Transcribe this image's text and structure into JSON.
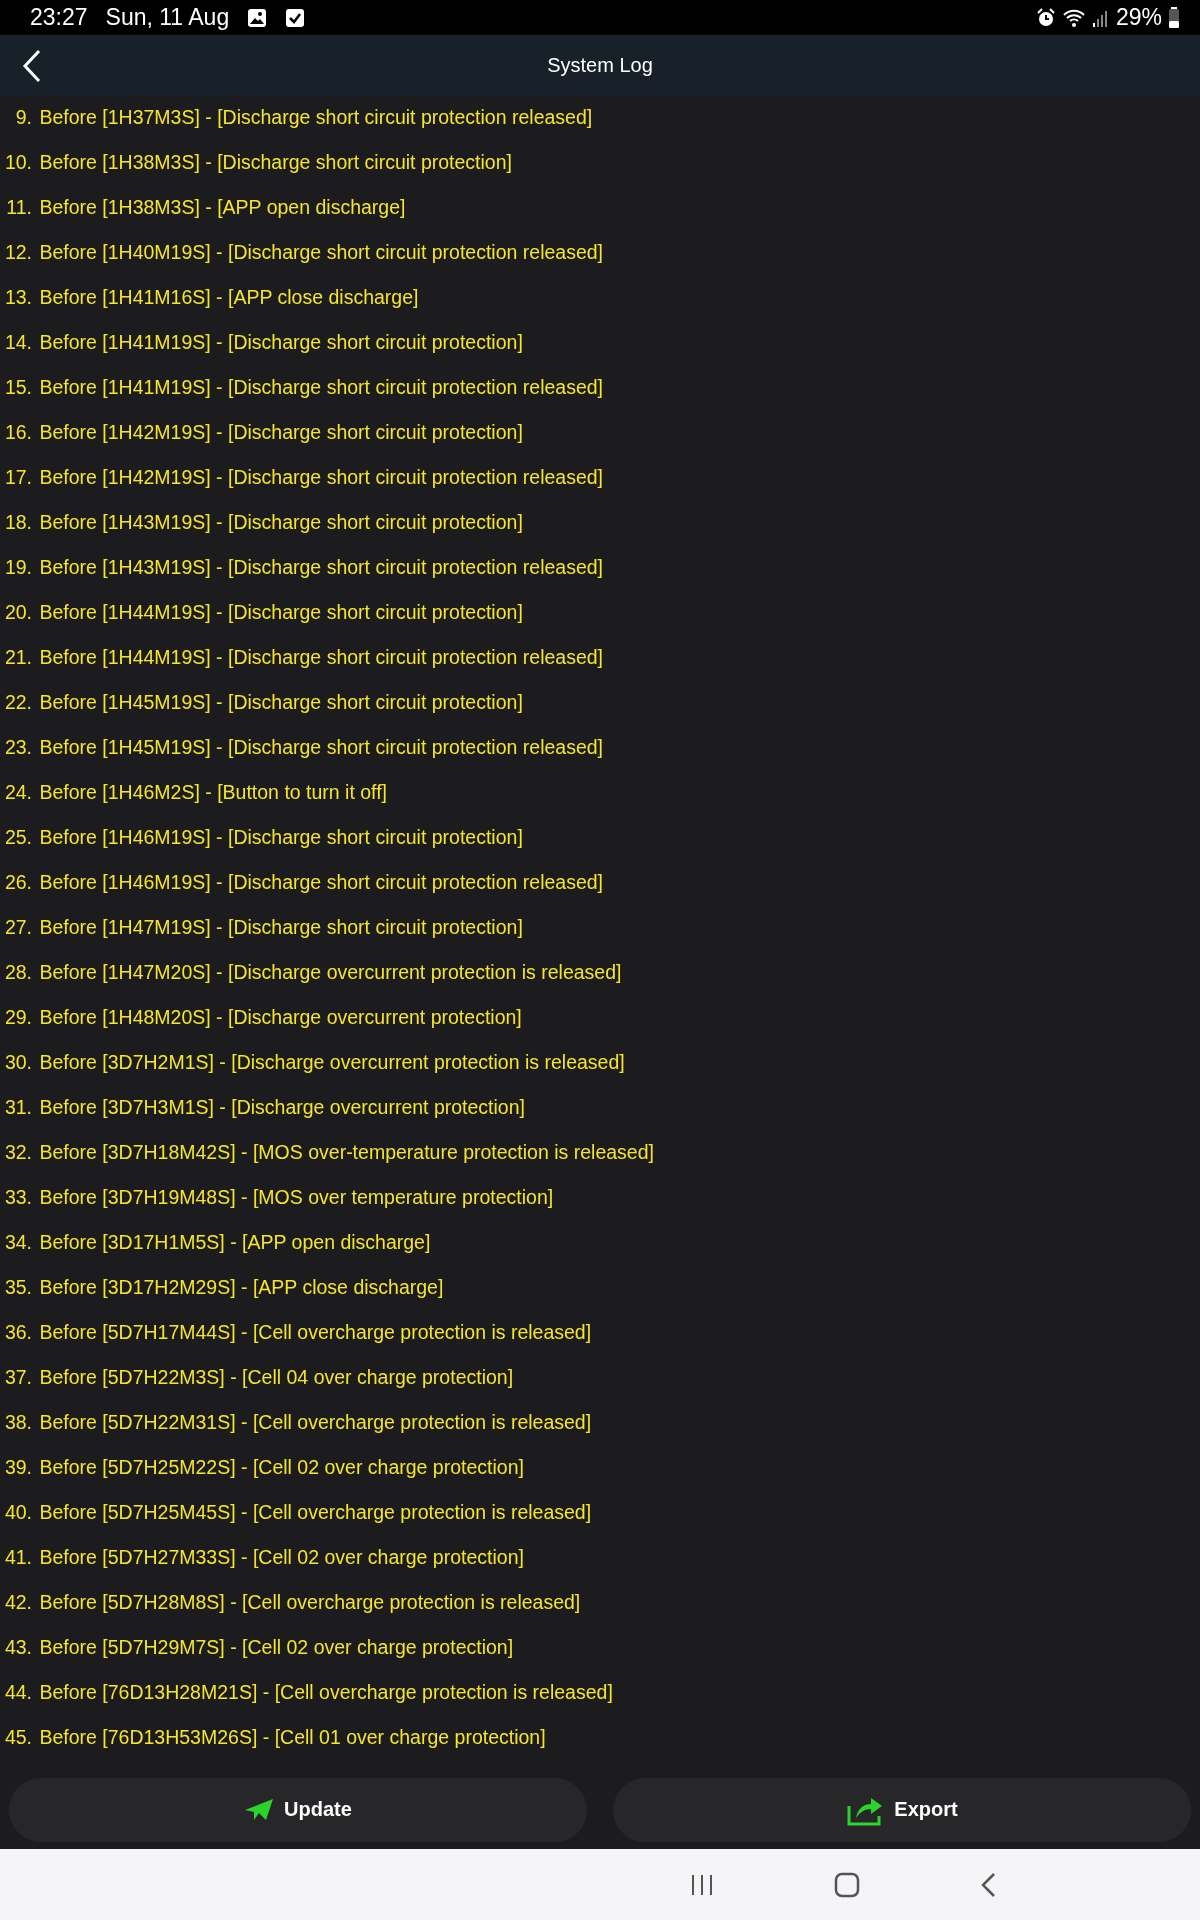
{
  "status_bar": {
    "time": "23:27",
    "date": "Sun, 11 Aug",
    "battery": "29%"
  },
  "header": {
    "title": "System Log"
  },
  "log_entries": [
    {
      "number": "9.",
      "text": "Before [1H37M3S] - [Discharge short circuit protection released]"
    },
    {
      "number": "10.",
      "text": "Before [1H38M3S] - [Discharge short circuit protection]"
    },
    {
      "number": "11.",
      "text": "Before [1H38M3S] - [APP open discharge]"
    },
    {
      "number": "12.",
      "text": "Before [1H40M19S] - [Discharge short circuit protection released]"
    },
    {
      "number": "13.",
      "text": "Before [1H41M16S] - [APP close discharge]"
    },
    {
      "number": "14.",
      "text": "Before [1H41M19S] - [Discharge short circuit protection]"
    },
    {
      "number": "15.",
      "text": "Before [1H41M19S] - [Discharge short circuit protection released]"
    },
    {
      "number": "16.",
      "text": "Before [1H42M19S] - [Discharge short circuit protection]"
    },
    {
      "number": "17.",
      "text": "Before [1H42M19S] - [Discharge short circuit protection released]"
    },
    {
      "number": "18.",
      "text": "Before [1H43M19S] - [Discharge short circuit protection]"
    },
    {
      "number": "19.",
      "text": "Before [1H43M19S] - [Discharge short circuit protection released]"
    },
    {
      "number": "20.",
      "text": "Before [1H44M19S] - [Discharge short circuit protection]"
    },
    {
      "number": "21.",
      "text": "Before [1H44M19S] - [Discharge short circuit protection released]"
    },
    {
      "number": "22.",
      "text": "Before [1H45M19S] - [Discharge short circuit protection]"
    },
    {
      "number": "23.",
      "text": "Before [1H45M19S] - [Discharge short circuit protection released]"
    },
    {
      "number": "24.",
      "text": "Before [1H46M2S] - [Button to turn it off]"
    },
    {
      "number": "25.",
      "text": "Before [1H46M19S] - [Discharge short circuit protection]"
    },
    {
      "number": "26.",
      "text": "Before [1H46M19S] - [Discharge short circuit protection released]"
    },
    {
      "number": "27.",
      "text": "Before [1H47M19S] - [Discharge short circuit protection]"
    },
    {
      "number": "28.",
      "text": "Before [1H47M20S] - [Discharge overcurrent protection is released]"
    },
    {
      "number": "29.",
      "text": "Before [1H48M20S] - [Discharge overcurrent protection]"
    },
    {
      "number": "30.",
      "text": "Before [3D7H2M1S] - [Discharge overcurrent protection is released]"
    },
    {
      "number": "31.",
      "text": "Before [3D7H3M1S] - [Discharge overcurrent protection]"
    },
    {
      "number": "32.",
      "text": "Before [3D7H18M42S] - [MOS over-temperature protection is released]"
    },
    {
      "number": "33.",
      "text": "Before [3D7H19M48S] - [MOS over temperature protection]"
    },
    {
      "number": "34.",
      "text": "Before [3D17H1M5S] - [APP open discharge]"
    },
    {
      "number": "35.",
      "text": "Before [3D17H2M29S] - [APP close discharge]"
    },
    {
      "number": "36.",
      "text": "Before [5D7H17M44S] - [Cell overcharge protection is released]"
    },
    {
      "number": "37.",
      "text": "Before [5D7H22M3S] - [Cell 04 over charge protection]"
    },
    {
      "number": "38.",
      "text": "Before [5D7H22M31S] - [Cell overcharge protection is released]"
    },
    {
      "number": "39.",
      "text": "Before [5D7H25M22S] - [Cell 02 over charge protection]"
    },
    {
      "number": "40.",
      "text": "Before [5D7H25M45S] - [Cell overcharge protection is released]"
    },
    {
      "number": "41.",
      "text": "Before [5D7H27M33S] - [Cell 02 over charge protection]"
    },
    {
      "number": "42.",
      "text": "Before [5D7H28M8S] - [Cell overcharge protection is released]"
    },
    {
      "number": "43.",
      "text": "Before [5D7H29M7S] - [Cell 02 over charge protection]"
    },
    {
      "number": "44.",
      "text": "Before [76D13H28M21S] - [Cell overcharge protection is released]"
    },
    {
      "number": "45.",
      "text": "Before [76D13H53M26S] - [Cell 01 over charge protection]"
    }
  ],
  "buttons": [
    {
      "kind": "update",
      "label": "Update"
    },
    {
      "kind": "export",
      "label": "Export"
    }
  ]
}
